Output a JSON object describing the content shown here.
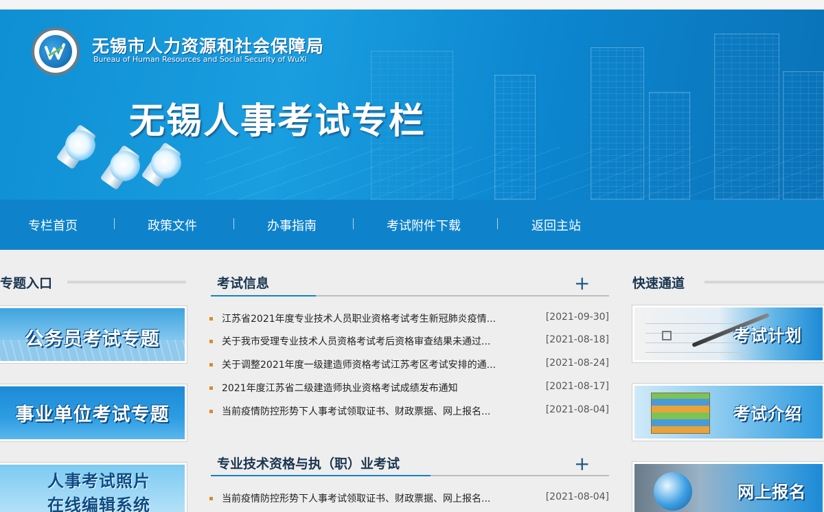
{
  "header": {
    "org_cn": "无锡市人力资源和社会保障局",
    "org_en": "Bureau of Human Resources and Social Security of WuXi",
    "title": "无锡人事考试专栏"
  },
  "nav": [
    "专栏首页",
    "政策文件",
    "办事指南",
    "考试附件下载",
    "返回主站"
  ],
  "left": {
    "title": "专题入口",
    "cards": [
      "公务员考试专题",
      "事业单位考试专题",
      "人事考试照片",
      "在线编辑系统"
    ]
  },
  "center": {
    "exam_info": {
      "title": "考试信息",
      "plus": "+",
      "items": [
        {
          "title": "江苏省2021年度专业技术人员职业资格考试考生新冠肺炎疫情...",
          "date": "[2021-09-30]"
        },
        {
          "title": "关于我市受理专业技术人员资格考试考后资格审查结果未通过...",
          "date": "[2021-08-18]"
        },
        {
          "title": "关于调整2021年度一级建造师资格考试江苏考区考试安排的通...",
          "date": "[2021-08-24]"
        },
        {
          "title": "2021年度江苏省二级建造师执业资格考试成绩发布通知",
          "date": "[2021-08-17]"
        },
        {
          "title": "当前疫情防控形势下人事考试领取证书、财政票据、网上报名...",
          "date": "[2021-08-04]"
        }
      ]
    },
    "prof_exam": {
      "title": "专业技术资格与执（职）业考试",
      "plus": "+",
      "items": [
        {
          "title": "当前疫情防控形势下人事考试领取证书、财政票据、网上报名...",
          "date": "[2021-08-04]"
        }
      ]
    }
  },
  "right": {
    "title": "快速通道",
    "cards": [
      "考试计划",
      "考试介绍",
      "网上报名"
    ]
  },
  "colors": {
    "nav_bg": "#0e83cc",
    "banner": "#1a9ee0",
    "accent": "#1280c4",
    "bullet": "#d98a2a"
  }
}
